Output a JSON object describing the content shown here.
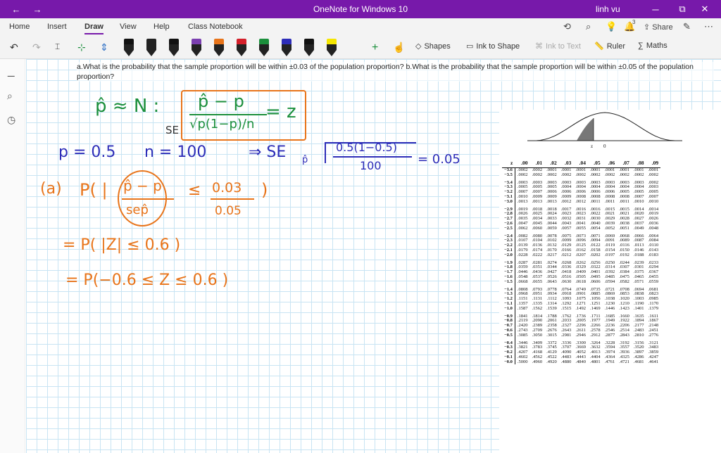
{
  "window": {
    "title": "OneNote for Windows 10",
    "user": "linh vu",
    "back_icon": "←",
    "forward_icon": "→",
    "min_icon": "─",
    "max_icon": "⧉",
    "close_icon": "✕"
  },
  "menu": {
    "items": [
      "Home",
      "Insert",
      "Draw",
      "View",
      "Help",
      "Class Notebook"
    ],
    "active": "Draw",
    "share_label": "Share",
    "notif_count": "3"
  },
  "toolbar": {
    "shapes_label": "Shapes",
    "ink_to_shape_label": "Ink to Shape",
    "ink_to_text_label": "Ink to Text",
    "ruler_label": "Ruler",
    "math_label": "Maths",
    "pen_colors": [
      "#111111",
      "#222222",
      "#111111",
      "#7b3fb0",
      "#e8741a",
      "#d31f2a",
      "#1b8f3c",
      "#2d2db8",
      "#111111",
      "#f5e600"
    ],
    "plus_label": "+"
  },
  "question": "a.What is the probability that the sample proportion will be within ±0.03 of the population proportion? b.What is the probability that the sample proportion will be within ±0.05 of the population proportion?",
  "handwriting": {
    "line1": "p̂ ≈ N :",
    "formula_num": "p̂ − p",
    "formula_se": "SE",
    "formula_den": "√p(1−p)/n",
    "formula_eq": "= z",
    "line2_p": "p = 0.5",
    "line2_n": "n = 100",
    "line2_se": "⇒ SE",
    "line2_se_sub": "p̂",
    "line2_expr_num": "0.5(1−0.5)",
    "line2_expr_den": "100",
    "line2_result": "= 0.05",
    "part_a_label": "(a)",
    "part_a_prob": "P( |",
    "part_a_num": "p̂ − p",
    "part_a_den": "sep̂",
    "part_a_leq": "≤",
    "part_a_rhs_num": "0.03",
    "part_a_rhs_den": "0.05",
    "part_a_close": ")",
    "line_b": "= P( |Z| ≤ 0.6 )",
    "line_c": "= P(−0.6 ≤ Z ≤ 0.6 )"
  },
  "ztable": {
    "headers": [
      "z",
      ".00",
      ".01",
      ".02",
      ".03",
      ".04",
      ".05",
      ".06",
      ".07",
      ".08",
      ".09"
    ],
    "rows": [
      [
        "−3.6",
        ".0002",
        ".0002",
        ".0001",
        ".0001",
        ".0001",
        ".0001",
        ".0001",
        ".0001",
        ".0001",
        ".0001"
      ],
      [
        "−3.5",
        ".0002",
        ".0002",
        ".0002",
        ".0002",
        ".0002",
        ".0002",
        ".0002",
        ".0002",
        ".0002",
        ".0002"
      ],
      [
        "−3.4",
        ".0003",
        ".0003",
        ".0003",
        ".0003",
        ".0003",
        ".0003",
        ".0003",
        ".0003",
        ".0003",
        ".0002"
      ],
      [
        "−3.3",
        ".0005",
        ".0005",
        ".0005",
        ".0004",
        ".0004",
        ".0004",
        ".0004",
        ".0004",
        ".0004",
        ".0003"
      ],
      [
        "−3.2",
        ".0007",
        ".0007",
        ".0006",
        ".0006",
        ".0006",
        ".0006",
        ".0006",
        ".0005",
        ".0005",
        ".0005"
      ],
      [
        "−3.1",
        ".0010",
        ".0009",
        ".0009",
        ".0009",
        ".0008",
        ".0008",
        ".0008",
        ".0008",
        ".0007",
        ".0007"
      ],
      [
        "−3.0",
        ".0013",
        ".0013",
        ".0013",
        ".0012",
        ".0012",
        ".0011",
        ".0011",
        ".0011",
        ".0010",
        ".0010"
      ],
      [
        "−2.9",
        ".0019",
        ".0018",
        ".0018",
        ".0017",
        ".0016",
        ".0016",
        ".0015",
        ".0015",
        ".0014",
        ".0014"
      ],
      [
        "−2.8",
        ".0026",
        ".0025",
        ".0024",
        ".0023",
        ".0023",
        ".0022",
        ".0021",
        ".0021",
        ".0020",
        ".0019"
      ],
      [
        "−2.7",
        ".0035",
        ".0034",
        ".0033",
        ".0032",
        ".0031",
        ".0030",
        ".0029",
        ".0028",
        ".0027",
        ".0026"
      ],
      [
        "−2.6",
        ".0047",
        ".0045",
        ".0044",
        ".0043",
        ".0041",
        ".0040",
        ".0039",
        ".0038",
        ".0037",
        ".0036"
      ],
      [
        "−2.5",
        ".0062",
        ".0060",
        ".0059",
        ".0057",
        ".0055",
        ".0054",
        ".0052",
        ".0051",
        ".0049",
        ".0048"
      ],
      [
        "−2.4",
        ".0082",
        ".0080",
        ".0078",
        ".0075",
        ".0073",
        ".0071",
        ".0069",
        ".0068",
        ".0066",
        ".0064"
      ],
      [
        "−2.3",
        ".0107",
        ".0104",
        ".0102",
        ".0099",
        ".0096",
        ".0094",
        ".0091",
        ".0089",
        ".0087",
        ".0084"
      ],
      [
        "−2.2",
        ".0139",
        ".0136",
        ".0132",
        ".0129",
        ".0125",
        ".0122",
        ".0119",
        ".0116",
        ".0113",
        ".0110"
      ],
      [
        "−2.1",
        ".0179",
        ".0174",
        ".0170",
        ".0166",
        ".0162",
        ".0158",
        ".0154",
        ".0150",
        ".0146",
        ".0143"
      ],
      [
        "−2.0",
        ".0228",
        ".0222",
        ".0217",
        ".0212",
        ".0207",
        ".0202",
        ".0197",
        ".0192",
        ".0188",
        ".0183"
      ],
      [
        "−1.9",
        ".0287",
        ".0281",
        ".0274",
        ".0268",
        ".0262",
        ".0256",
        ".0250",
        ".0244",
        ".0239",
        ".0233"
      ],
      [
        "−1.8",
        ".0359",
        ".0351",
        ".0344",
        ".0336",
        ".0329",
        ".0322",
        ".0314",
        ".0307",
        ".0301",
        ".0294"
      ],
      [
        "−1.7",
        ".0446",
        ".0436",
        ".0427",
        ".0418",
        ".0409",
        ".0401",
        ".0392",
        ".0384",
        ".0375",
        ".0367"
      ],
      [
        "−1.6",
        ".0548",
        ".0537",
        ".0526",
        ".0516",
        ".0505",
        ".0495",
        ".0485",
        ".0475",
        ".0465",
        ".0455"
      ],
      [
        "−1.5",
        ".0668",
        ".0655",
        ".0643",
        ".0630",
        ".0618",
        ".0606",
        ".0594",
        ".0582",
        ".0571",
        ".0559"
      ],
      [
        "−1.4",
        ".0808",
        ".0793",
        ".0778",
        ".0764",
        ".0749",
        ".0735",
        ".0721",
        ".0708",
        ".0694",
        ".0681"
      ],
      [
        "−1.3",
        ".0968",
        ".0951",
        ".0934",
        ".0918",
        ".0901",
        ".0885",
        ".0869",
        ".0853",
        ".0838",
        ".0823"
      ],
      [
        "−1.2",
        ".1151",
        ".1131",
        ".1112",
        ".1093",
        ".1075",
        ".1056",
        ".1038",
        ".1020",
        ".1003",
        ".0985"
      ],
      [
        "−1.1",
        ".1357",
        ".1335",
        ".1314",
        ".1292",
        ".1271",
        ".1251",
        ".1230",
        ".1210",
        ".1190",
        ".1170"
      ],
      [
        "−1.0",
        ".1587",
        ".1562",
        ".1539",
        ".1515",
        ".1492",
        ".1469",
        ".1446",
        ".1423",
        ".1401",
        ".1379"
      ],
      [
        "−0.9",
        ".1841",
        ".1814",
        ".1788",
        ".1762",
        ".1736",
        ".1711",
        ".1685",
        ".1660",
        ".1635",
        ".1611"
      ],
      [
        "−0.8",
        ".2119",
        ".2090",
        ".2061",
        ".2033",
        ".2005",
        ".1977",
        ".1949",
        ".1922",
        ".1894",
        ".1867"
      ],
      [
        "−0.7",
        ".2420",
        ".2389",
        ".2358",
        ".2327",
        ".2296",
        ".2266",
        ".2236",
        ".2206",
        ".2177",
        ".2148"
      ],
      [
        "−0.6",
        ".2743",
        ".2709",
        ".2676",
        ".2643",
        ".2611",
        ".2578",
        ".2546",
        ".2514",
        ".2483",
        ".2451"
      ],
      [
        "−0.5",
        ".3085",
        ".3050",
        ".3015",
        ".2981",
        ".2946",
        ".2912",
        ".2877",
        ".2843",
        ".2810",
        ".2776"
      ],
      [
        "−0.4",
        ".3446",
        ".3409",
        ".3372",
        ".3336",
        ".3300",
        ".3264",
        ".3228",
        ".3192",
        ".3156",
        ".3121"
      ],
      [
        "−0.3",
        ".3821",
        ".3783",
        ".3745",
        ".3707",
        ".3669",
        ".3632",
        ".3594",
        ".3557",
        ".3520",
        ".3483"
      ],
      [
        "−0.2",
        ".4207",
        ".4168",
        ".4129",
        ".4090",
        ".4052",
        ".4013",
        ".3974",
        ".3936",
        ".3897",
        ".3859"
      ],
      [
        "−0.1",
        ".4602",
        ".4562",
        ".4522",
        ".4483",
        ".4443",
        ".4404",
        ".4364",
        ".4325",
        ".4286",
        ".4247"
      ],
      [
        "−0.0",
        ".5000",
        ".4960",
        ".4920",
        ".4880",
        ".4840",
        ".4801",
        ".4761",
        ".4721",
        ".4681",
        ".4641"
      ]
    ],
    "curve_label_z": "z",
    "curve_label_zero": "0"
  }
}
